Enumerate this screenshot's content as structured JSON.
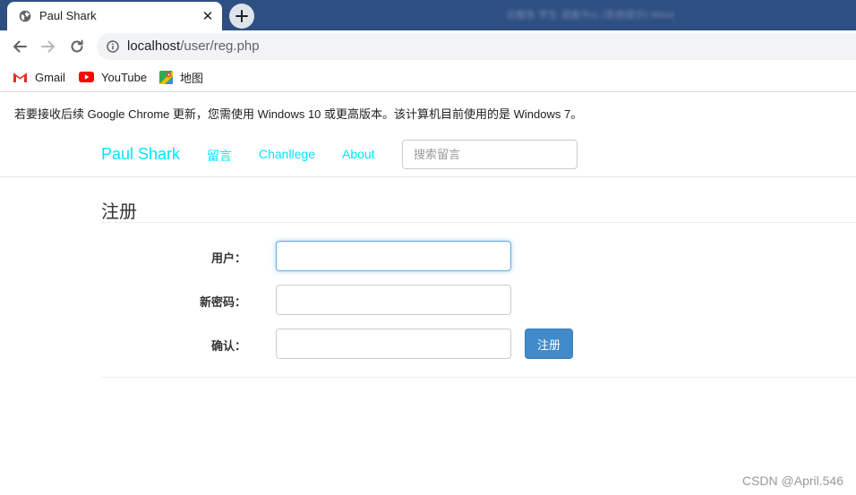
{
  "browser": {
    "tab": {
      "title": "Paul Shark",
      "close": "✕"
    },
    "new_tab": "+",
    "titlebar_blurred": "云服务 学生 调查中心 [系统提示]  Word",
    "url": {
      "host": "localhost",
      "path": "/user/reg.php"
    },
    "bookmarks": [
      {
        "label": "Gmail",
        "icon": "gmail-icon"
      },
      {
        "label": "YouTube",
        "icon": "youtube-icon"
      },
      {
        "label": "地图",
        "icon": "maps-icon"
      }
    ],
    "infobar": "若要接收后续 Google Chrome 更新，您需使用 Windows 10 或更高版本。该计算机目前使用的是 Windows 7。"
  },
  "site": {
    "brand": "Paul Shark",
    "nav": [
      "留言",
      "Chanllege",
      "About"
    ],
    "search_placeholder": "搜索留言",
    "link_color": "#00e5ff"
  },
  "form": {
    "title": "注册",
    "fields": [
      {
        "label": "用户：",
        "value": ""
      },
      {
        "label": "新密码：",
        "value": ""
      },
      {
        "label": "确认：",
        "value": ""
      }
    ],
    "submit": "注册",
    "button_color": "#428bca"
  },
  "watermark": "CSDN @April.546"
}
